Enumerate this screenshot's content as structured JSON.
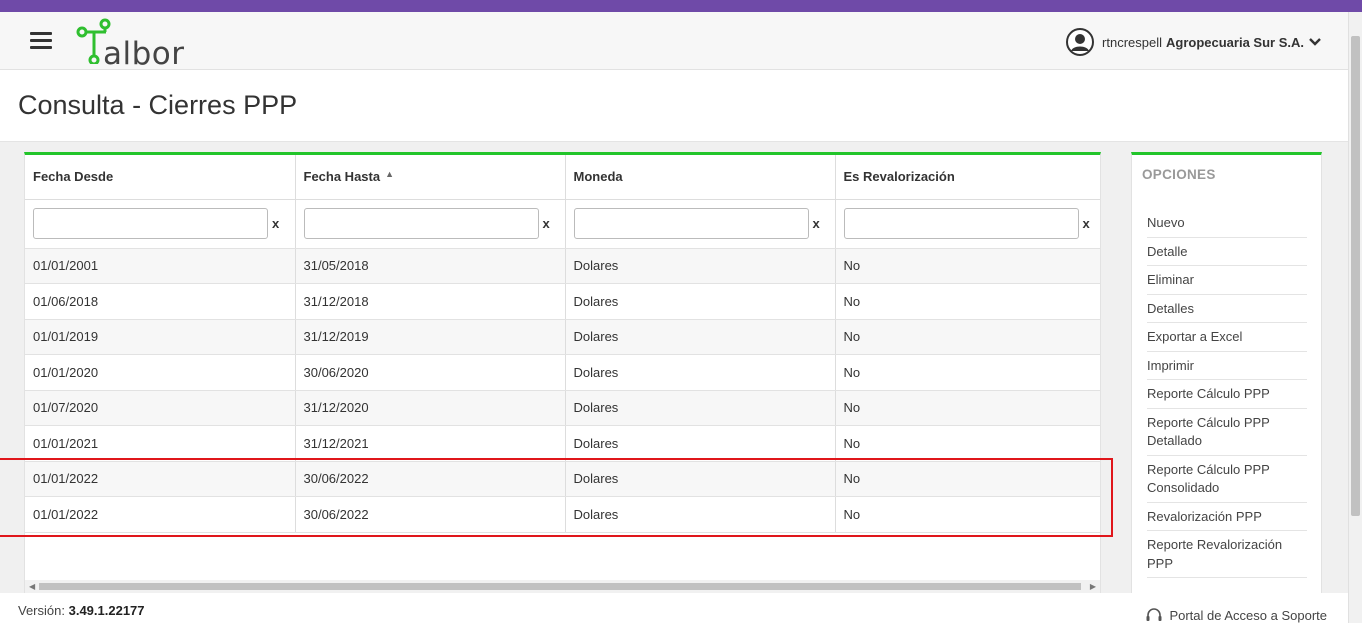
{
  "header": {
    "logo_text": "albor",
    "username": "rtncrespell",
    "company": "Agropecuaria Sur S.A."
  },
  "page_title": "Consulta - Cierres PPP",
  "table": {
    "columns": [
      "Fecha Desde",
      "Fecha Hasta",
      "Moneda",
      "Es Revalorización"
    ],
    "sorted_column": "Fecha Hasta",
    "filter_clear": "x",
    "rows": [
      [
        "01/01/2001",
        "31/05/2018",
        "Dolares",
        "No"
      ],
      [
        "01/06/2018",
        "31/12/2018",
        "Dolares",
        "No"
      ],
      [
        "01/01/2019",
        "31/12/2019",
        "Dolares",
        "No"
      ],
      [
        "01/01/2020",
        "30/06/2020",
        "Dolares",
        "No"
      ],
      [
        "01/07/2020",
        "31/12/2020",
        "Dolares",
        "No"
      ],
      [
        "01/01/2021",
        "31/12/2021",
        "Dolares",
        "No"
      ],
      [
        "01/01/2022",
        "30/06/2022",
        "Dolares",
        "No"
      ],
      [
        "01/01/2022",
        "30/06/2022",
        "Dolares",
        "No"
      ]
    ]
  },
  "options": {
    "title": "OPCIONES",
    "items": [
      "Nuevo",
      "Detalle",
      "Eliminar",
      "Detalles",
      "Exportar a Excel",
      "Imprimir",
      "Reporte Cálculo PPP",
      "Reporte Cálculo PPP Detallado",
      "Reporte Cálculo PPP Consolidado",
      "Revalorización PPP",
      "Reporte Revalorización PPP"
    ]
  },
  "footer": {
    "version_label": "Versión:",
    "version_value": "3.49.1.22177",
    "portal_label": "Portal de Acceso a Soporte"
  },
  "colors": {
    "accent_green": "#22c52a",
    "top_bar_purple": "#6f4aa8",
    "highlight_red": "#e0161b"
  },
  "icons": {
    "menu": "hamburger-icon",
    "user": "user-circle-icon",
    "dropdown": "chevron-down-icon",
    "sort": "sort-asc-icon",
    "support": "headset-icon"
  }
}
